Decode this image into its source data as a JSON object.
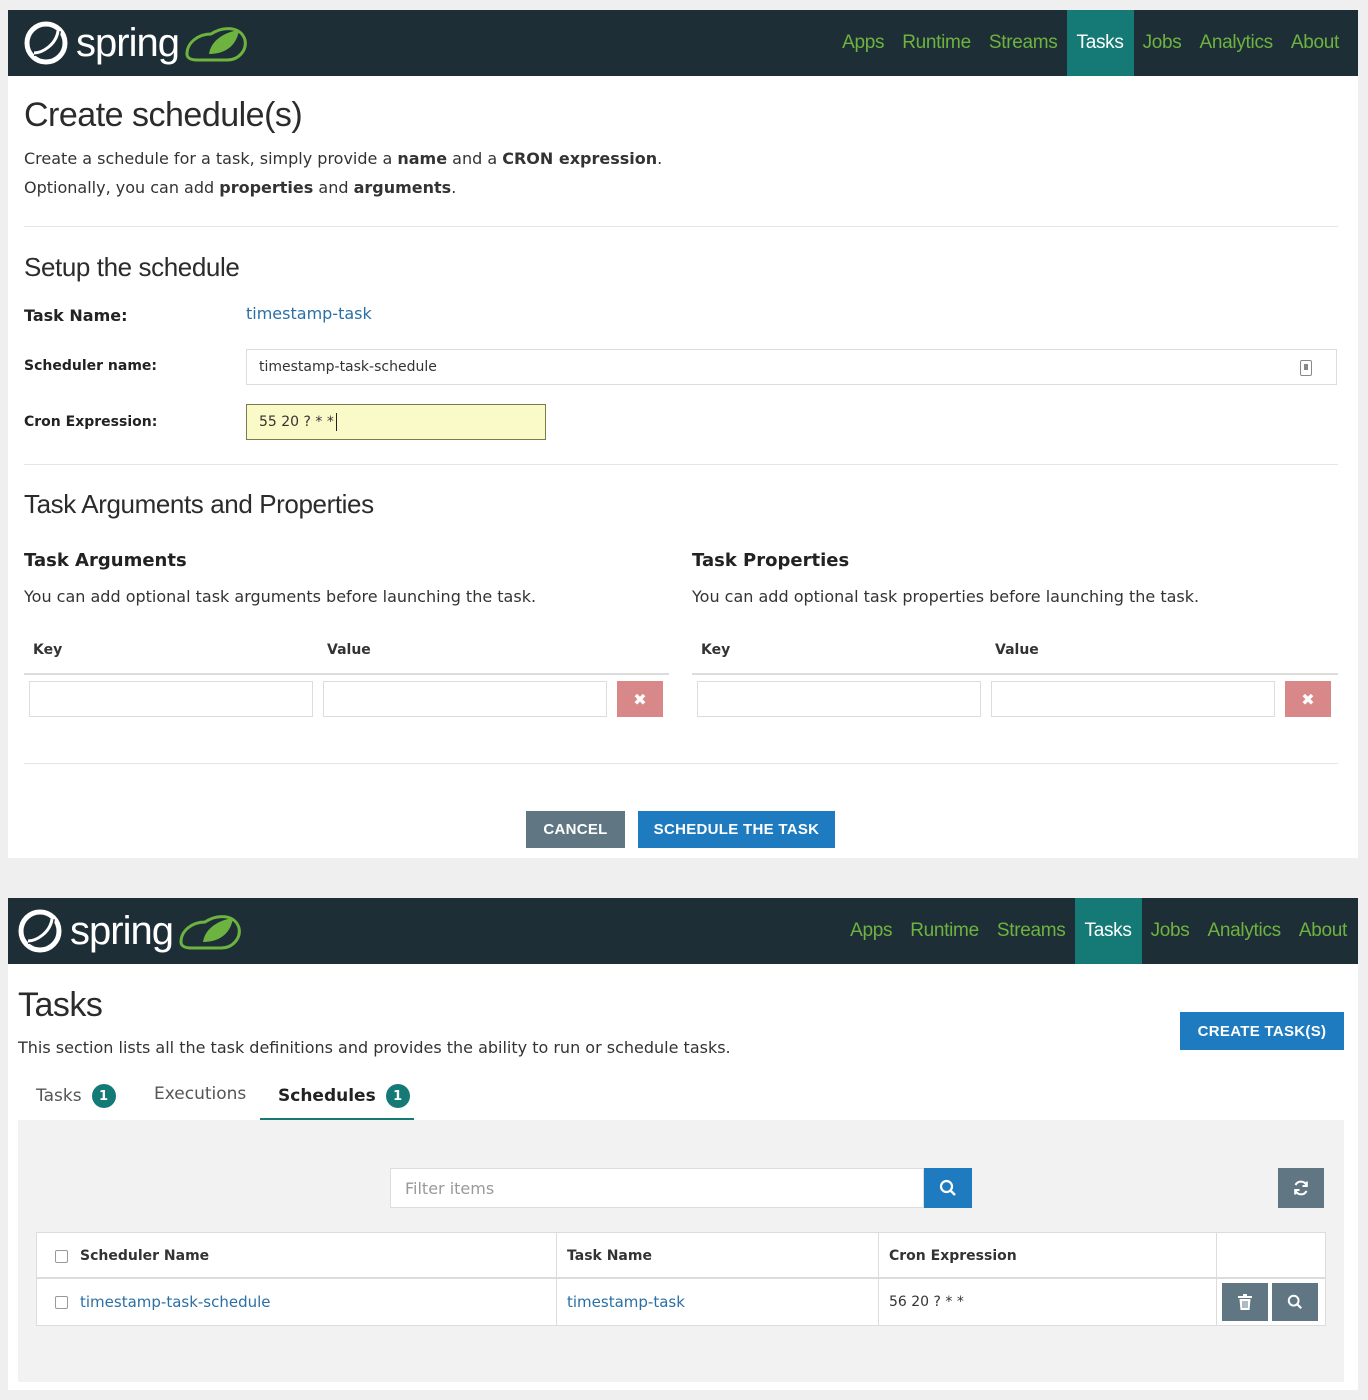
{
  "colors": {
    "navbar": "#1e2e36",
    "brand_green": "#6db33f",
    "active_teal": "#157a75",
    "primary_blue": "#1e7bc0",
    "secondary_gray": "#607783",
    "danger": "#d9888a",
    "highlight": "#fafac8"
  },
  "brand": {
    "name": "spring",
    "logo_icon": "spring-power-leaf-icon"
  },
  "nav": {
    "apps": "Apps",
    "runtime": "Runtime",
    "streams": "Streams",
    "tasks": "Tasks",
    "jobs": "Jobs",
    "analytics": "Analytics",
    "about": "About",
    "active": "Tasks"
  },
  "create": {
    "title": "Create schedule(s)",
    "intro1_a": "Create a schedule for a task, simply provide a ",
    "intro1_b": "name",
    "intro1_c": " and a ",
    "intro1_d": "CRON expression",
    "intro1_e": ".",
    "intro2_a": "Optionally, you can add ",
    "intro2_b": "properties",
    "intro2_c": " and ",
    "intro2_d": "arguments",
    "intro2_e": ".",
    "setup_title": "Setup the schedule",
    "task_name_label": "Task Name:",
    "task_name_value": "timestamp-task",
    "scheduler_name_label": "Scheduler name:",
    "scheduler_name_value": "timestamp-task-schedule",
    "cron_label": "Cron Expression:",
    "cron_value": "55 20 ? * *",
    "args_props_title": "Task Arguments and Properties",
    "args_title": "Task Arguments",
    "args_desc": "You can add optional task arguments before launching the task.",
    "props_title": "Task Properties",
    "props_desc": "You can add optional task properties before launching the task.",
    "key_header": "Key",
    "value_header": "Value",
    "delete_symbol": "✖",
    "cancel_label": "CANCEL",
    "schedule_label": "SCHEDULE THE TASK"
  },
  "tasks": {
    "title": "Tasks",
    "desc": "This section lists all the task definitions and provides the ability to run or schedule tasks.",
    "create_label": "CREATE TASK(S)",
    "tabs": [
      {
        "label": "Tasks",
        "badge": "1"
      },
      {
        "label": "Executions"
      },
      {
        "label": "Schedules",
        "badge": "1"
      }
    ],
    "active_tab": "Schedules",
    "filter_placeholder": "Filter items",
    "table": {
      "headers": [
        "Scheduler Name",
        "Task Name",
        "Cron Expression"
      ],
      "rows": [
        {
          "scheduler": "timestamp-task-schedule",
          "task": "timestamp-task",
          "cron": "56 20 ? * *"
        }
      ]
    }
  }
}
